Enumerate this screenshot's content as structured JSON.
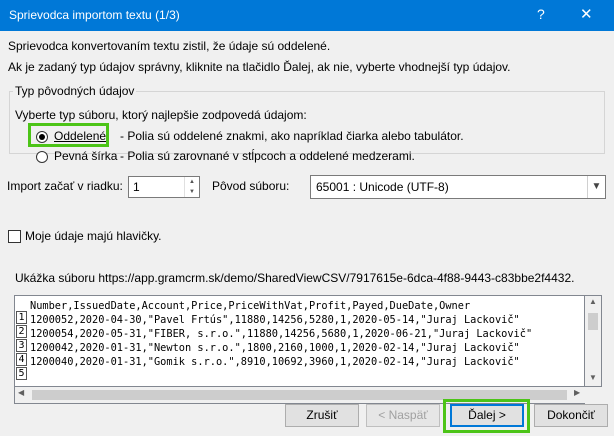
{
  "window": {
    "title": "Sprievodca importom textu (1/3)",
    "help_glyph": "?",
    "close_glyph": "✕"
  },
  "intro": {
    "line1": "Sprievodca konvertovaním textu zistil, že údaje sú oddelené.",
    "line2": "Ak je zadaný typ údajov správny, kliknite na tlačidlo Ďalej, ak nie, vyberte vhodnejší typ údajov."
  },
  "original_data_type": {
    "legend": "Typ pôvodných údajov",
    "hint": "Vyberte typ súboru, ktorý najlepšie zodpovedá údajom:",
    "options": [
      {
        "label": "Oddelené",
        "description": "- Polia sú oddelené znakmi, ako napríklad čiarka alebo tabulátor.",
        "selected": true
      },
      {
        "label": "Pevná šírka",
        "description": "- Polia sú zarovnané v stĺpcoch a oddelené medzerami.",
        "selected": false
      }
    ]
  },
  "start_row": {
    "label": "Import začať v riadku:",
    "value": "1"
  },
  "file_origin": {
    "label": "Pôvod súboru:",
    "value": "65001 : Unicode (UTF-8)"
  },
  "headers_checkbox": {
    "label": "Moje údaje majú hlavičky.",
    "checked": false
  },
  "preview": {
    "label": "Ukážka súboru https://app.gramcrm.sk/demo/SharedViewCSV/7917615e-6dca-4f88-9443-c83bbe2f4432.",
    "rows": [
      {
        "num": "1",
        "text": "Number,IssuedDate,Account,Price,PriceWithVat,Profit,Payed,DueDate,Owner"
      },
      {
        "num": "2",
        "text": "1200052,2020-04-30,\"Pavel Frtús\",11880,14256,5280,1,2020-05-14,\"Juraj Lackovič\""
      },
      {
        "num": "3",
        "text": "1200054,2020-05-31,\"FIBER, s.r.o.\",11880,14256,5680,1,2020-06-21,\"Juraj Lackovič\""
      },
      {
        "num": "4",
        "text": "1200042,2020-01-31,\"Newton s.r.o.\",1800,2160,1000,1,2020-02-14,\"Juraj Lackovič\""
      },
      {
        "num": "5",
        "text": "1200040,2020-01-31,\"Gomik s.r.o.\",8910,10692,3960,1,2020-02-14,\"Juraj Lackovič\""
      }
    ]
  },
  "buttons": {
    "cancel": "Zrušiť",
    "back": "< Naspäť",
    "next": "Ďalej >",
    "finish": "Dokončiť"
  },
  "colors": {
    "titlebar": "#0078d7",
    "highlight": "#4cc417"
  }
}
